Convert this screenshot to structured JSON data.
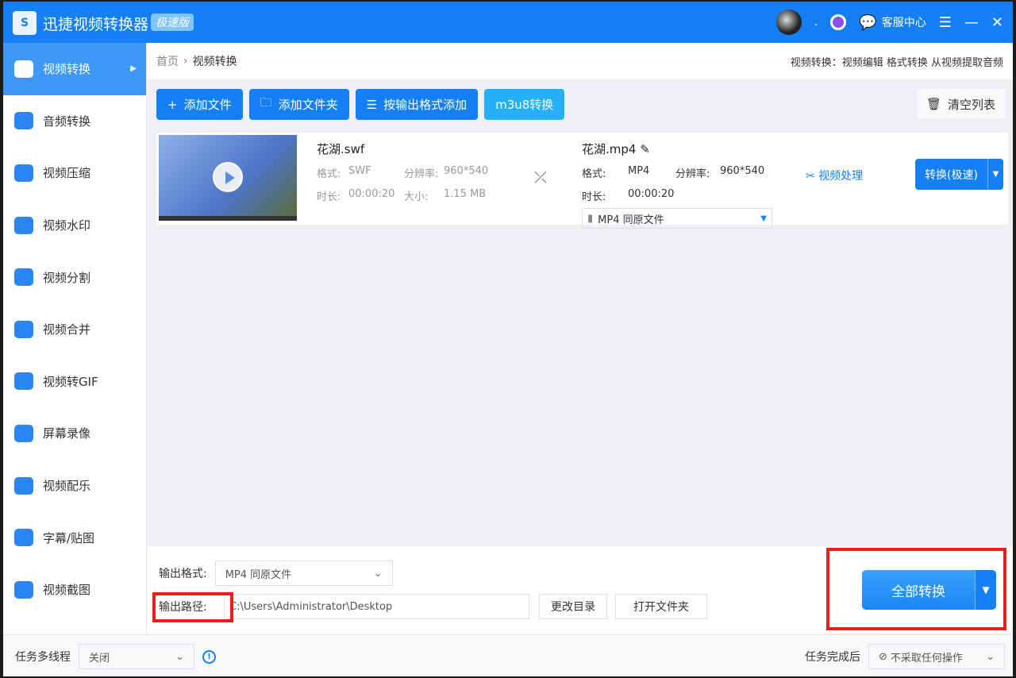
{
  "titlebar": {
    "logo": "S",
    "title": "迅捷视频转换器",
    "edition": "极速版",
    "service": "客服中心",
    "dot": "."
  },
  "sidebar": {
    "items": [
      {
        "label": "视频转换",
        "active": true
      },
      {
        "label": "音频转换"
      },
      {
        "label": "视频压缩"
      },
      {
        "label": "视频水印"
      },
      {
        "label": "视频分割"
      },
      {
        "label": "视频合并"
      },
      {
        "label": "视频转GIF"
      },
      {
        "label": "屏幕录像"
      },
      {
        "label": "视频配乐"
      },
      {
        "label": "字幕/贴图"
      },
      {
        "label": "视频截图"
      }
    ]
  },
  "breadcrumb": {
    "home": "首页",
    "sep": "›",
    "current": "视频转换",
    "tip": "视频转换：视频编辑 格式转换 从视频提取音频"
  },
  "toolbar": {
    "add_file": "添加文件",
    "add_folder": "添加文件夹",
    "add_by_format": "按输出格式添加",
    "m3u8": "m3u8转换",
    "clear": "清空列表"
  },
  "file": {
    "source": {
      "name": "花湖.swf",
      "format_label": "格式:",
      "format": "SWF",
      "res_label": "分辨率:",
      "resolution": "960*540",
      "dur_label": "时长:",
      "duration": "00:00:20",
      "size_label": "大小:",
      "size": "1.15 MB"
    },
    "target": {
      "name": "花湖.mp4",
      "format_label": "格式:",
      "format": "MP4",
      "res_label": "分辨率:",
      "resolution": "960*540",
      "dur_label": "时长:",
      "duration": "00:00:20",
      "preset": "MP4  同原文件"
    },
    "video_process": "视频处理",
    "convert": "转换(极速)"
  },
  "bottom": {
    "format_label": "输出格式:",
    "format_value": "MP4  同原文件",
    "path_label": "输出路径:",
    "path_value": "C:\\Users\\Administrator\\Desktop",
    "change_dir": "更改目录",
    "open_folder": "打开文件夹",
    "convert_all": "全部转换"
  },
  "footer": {
    "multithread_label": "任务多线程",
    "multithread_value": "关闭",
    "after_label": "任务完成后",
    "after_value": "不采取任何操作"
  },
  "colors": {
    "primary": "#1580f5",
    "highlight": "#ee1c1c"
  }
}
